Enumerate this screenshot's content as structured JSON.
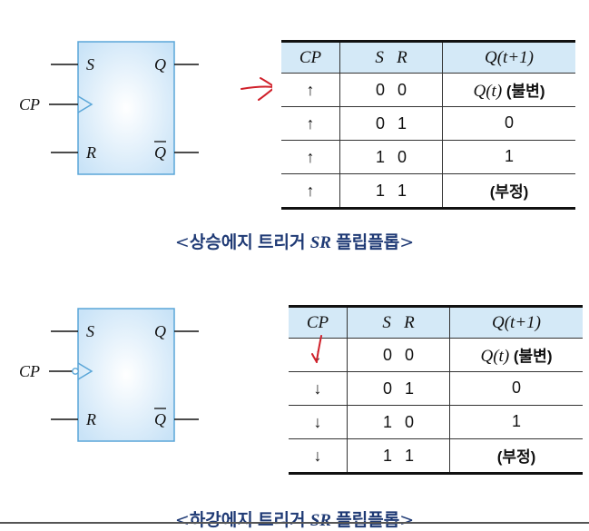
{
  "rising": {
    "symbol": {
      "s": "S",
      "r": "R",
      "q": "Q",
      "qbar": "Q",
      "cp": "CP"
    },
    "table": {
      "headers": [
        "CP",
        "S   R",
        "Q(t+1)"
      ],
      "rows": [
        {
          "cp": "↑",
          "s": "0",
          "r": "0",
          "q_italic": "Q(t)",
          "q_bold": " (불변)"
        },
        {
          "cp": "↑",
          "s": "0",
          "r": "1",
          "q_italic": "",
          "q_bold": "0"
        },
        {
          "cp": "↑",
          "s": "1",
          "r": "0",
          "q_italic": "",
          "q_bold": "1"
        },
        {
          "cp": "↑",
          "s": "1",
          "r": "1",
          "q_italic": "",
          "q_bold": "(부정)"
        }
      ]
    },
    "caption": {
      "open": "<",
      "pre": "상승에지 트리거 ",
      "sr": "SR",
      "post": " 플립플롭",
      "close": ">"
    }
  },
  "falling": {
    "symbol": {
      "s": "S",
      "r": "R",
      "q": "Q",
      "qbar": "Q",
      "cp": "CP"
    },
    "table": {
      "headers": [
        "CP",
        "S   R",
        "Q(t+1)"
      ],
      "rows": [
        {
          "cp": "↓",
          "s": "0",
          "r": "0",
          "q_italic": "Q(t)",
          "q_bold": " (불변)"
        },
        {
          "cp": "↓",
          "s": "0",
          "r": "1",
          "q_italic": "",
          "q_bold": "0"
        },
        {
          "cp": "↓",
          "s": "1",
          "r": "0",
          "q_italic": "",
          "q_bold": "1"
        },
        {
          "cp": "↓",
          "s": "1",
          "r": "1",
          "q_italic": "",
          "q_bold": "(부정)"
        }
      ]
    },
    "caption": {
      "open": "<",
      "pre": "하강에지 트리거 ",
      "sr": "SR",
      "post": " 플립플롭",
      "close": ">"
    }
  },
  "colors": {
    "box_fill": "#d9ecfa",
    "box_stroke": "#5aa6d8",
    "header_fill": "#d4e9f7",
    "caption": "#1f3a75",
    "annotation": "#d0202a"
  }
}
